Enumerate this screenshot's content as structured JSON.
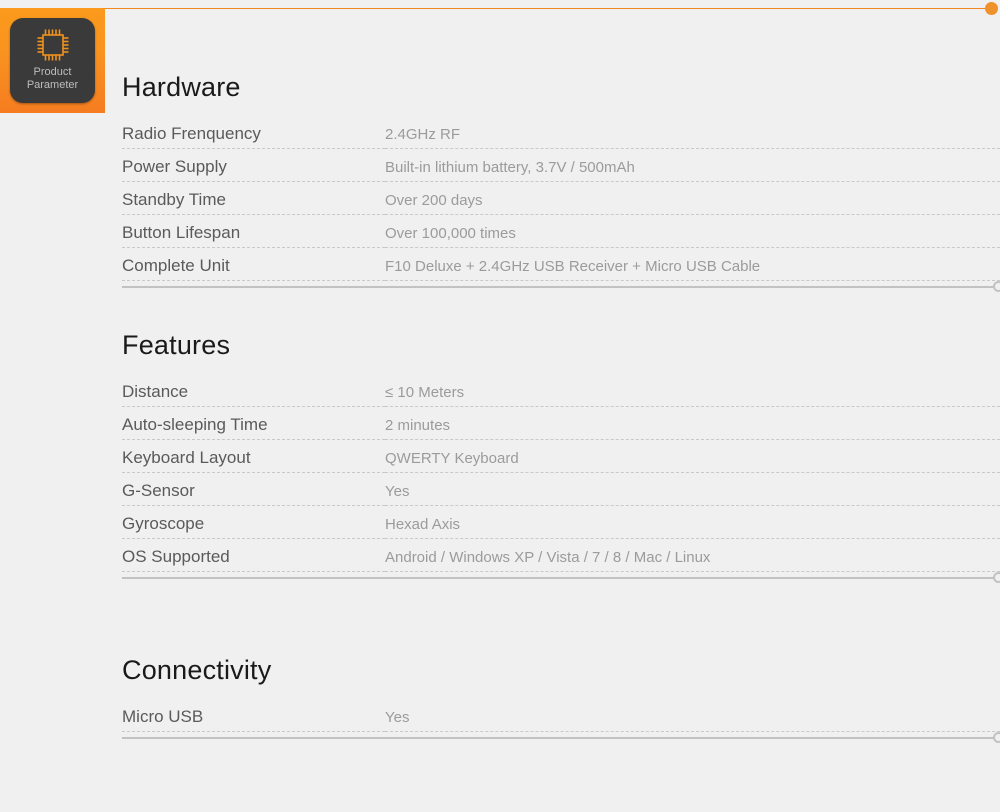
{
  "badge": {
    "icon": "cpu-chip-icon",
    "line1": "Product",
    "line2": "Parameter",
    "accent_color": "#f5871f",
    "panel_color": "#3a3a3a"
  },
  "accent": {
    "line_color": "#ef8a22",
    "dot_color": "#f0922a"
  },
  "rule": {
    "color": "#c2c2c2"
  },
  "sections": [
    {
      "title": "Hardware",
      "rows": [
        {
          "label": "Radio Frenquency",
          "value": "2.4GHz RF"
        },
        {
          "label": "Power Supply",
          "value": "Built-in lithium battery, 3.7V / 500mAh"
        },
        {
          "label": "Standby Time",
          "value": "Over 200 days"
        },
        {
          "label": "Button Lifespan",
          "value": "Over 100,000 times"
        },
        {
          "label": "Complete Unit",
          "value": "F10 Deluxe + 2.4GHz USB Receiver + Micro USB Cable"
        }
      ]
    },
    {
      "title": "Features",
      "rows": [
        {
          "label": "Distance",
          "value": "≤ 10 Meters"
        },
        {
          "label": "Auto-sleeping Time",
          "value": "2 minutes"
        },
        {
          "label": "Keyboard Layout",
          "value": "QWERTY Keyboard"
        },
        {
          "label": "G-Sensor",
          "value": "Yes"
        },
        {
          "label": "Gyroscope",
          "value": "Hexad Axis"
        },
        {
          "label": "OS Supported",
          "value": "Android / Windows XP / Vista / 7 / 8 / Mac / Linux"
        }
      ]
    },
    {
      "title": "Connectivity",
      "rows": [
        {
          "label": "Micro USB",
          "value": "Yes"
        }
      ]
    }
  ]
}
